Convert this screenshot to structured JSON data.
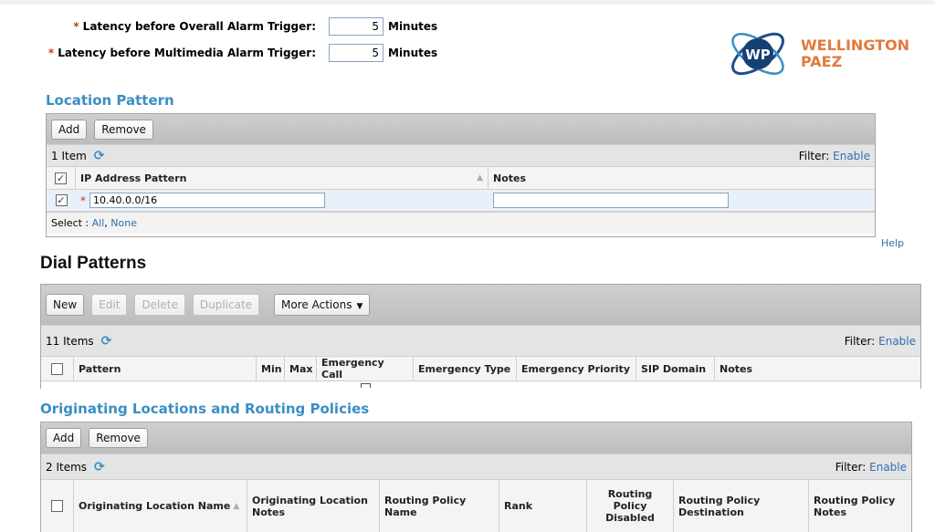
{
  "alarms": [
    {
      "label": "Latency before Overall Alarm Trigger:",
      "value": "5",
      "unit": "Minutes"
    },
    {
      "label": "Latency before Multimedia Alarm Trigger:",
      "value": "5",
      "unit": "Minutes"
    }
  ],
  "logo": {
    "line1": "WELLINGTON",
    "line2": "PAEZ",
    "badge": "WP",
    "color": "#e07b3b"
  },
  "location_pattern": {
    "title": "Location Pattern",
    "buttons": {
      "add": "Add",
      "remove": "Remove"
    },
    "count": "1 Item",
    "filter_label": "Filter:",
    "filter_link": "Enable",
    "columns": [
      "IP Address Pattern",
      "Notes"
    ],
    "rows": [
      {
        "ip": "10.40.0.0/16",
        "notes": ""
      }
    ],
    "select_label": "Select :",
    "select_all": "All",
    "select_none": "None"
  },
  "help": "Help",
  "dial_patterns": {
    "title": "Dial Patterns",
    "buttons": {
      "new": "New",
      "edit": "Edit",
      "delete": "Delete",
      "duplicate": "Duplicate",
      "more": "More Actions"
    },
    "count": "11 Items",
    "filter_label": "Filter:",
    "filter_link": "Enable",
    "columns": [
      "Pattern",
      "Min",
      "Max",
      "Emergency Call",
      "Emergency Type",
      "Emergency Priority",
      "SIP Domain",
      "Notes"
    ]
  },
  "orig_locations": {
    "title": "Originating Locations and Routing Policies",
    "buttons": {
      "add": "Add",
      "remove": "Remove"
    },
    "count": "2 Items",
    "filter_label": "Filter:",
    "filter_link": "Enable",
    "columns": [
      "Originating Location Name",
      "Originating Location Notes",
      "Routing Policy Name",
      "Rank",
      "Routing Policy Disabled",
      "Routing Policy Destination",
      "Routing Policy Notes"
    ]
  },
  "colors": {
    "accent": "#3b8ec4",
    "required": "#c0392b",
    "link": "#2f6fae"
  }
}
